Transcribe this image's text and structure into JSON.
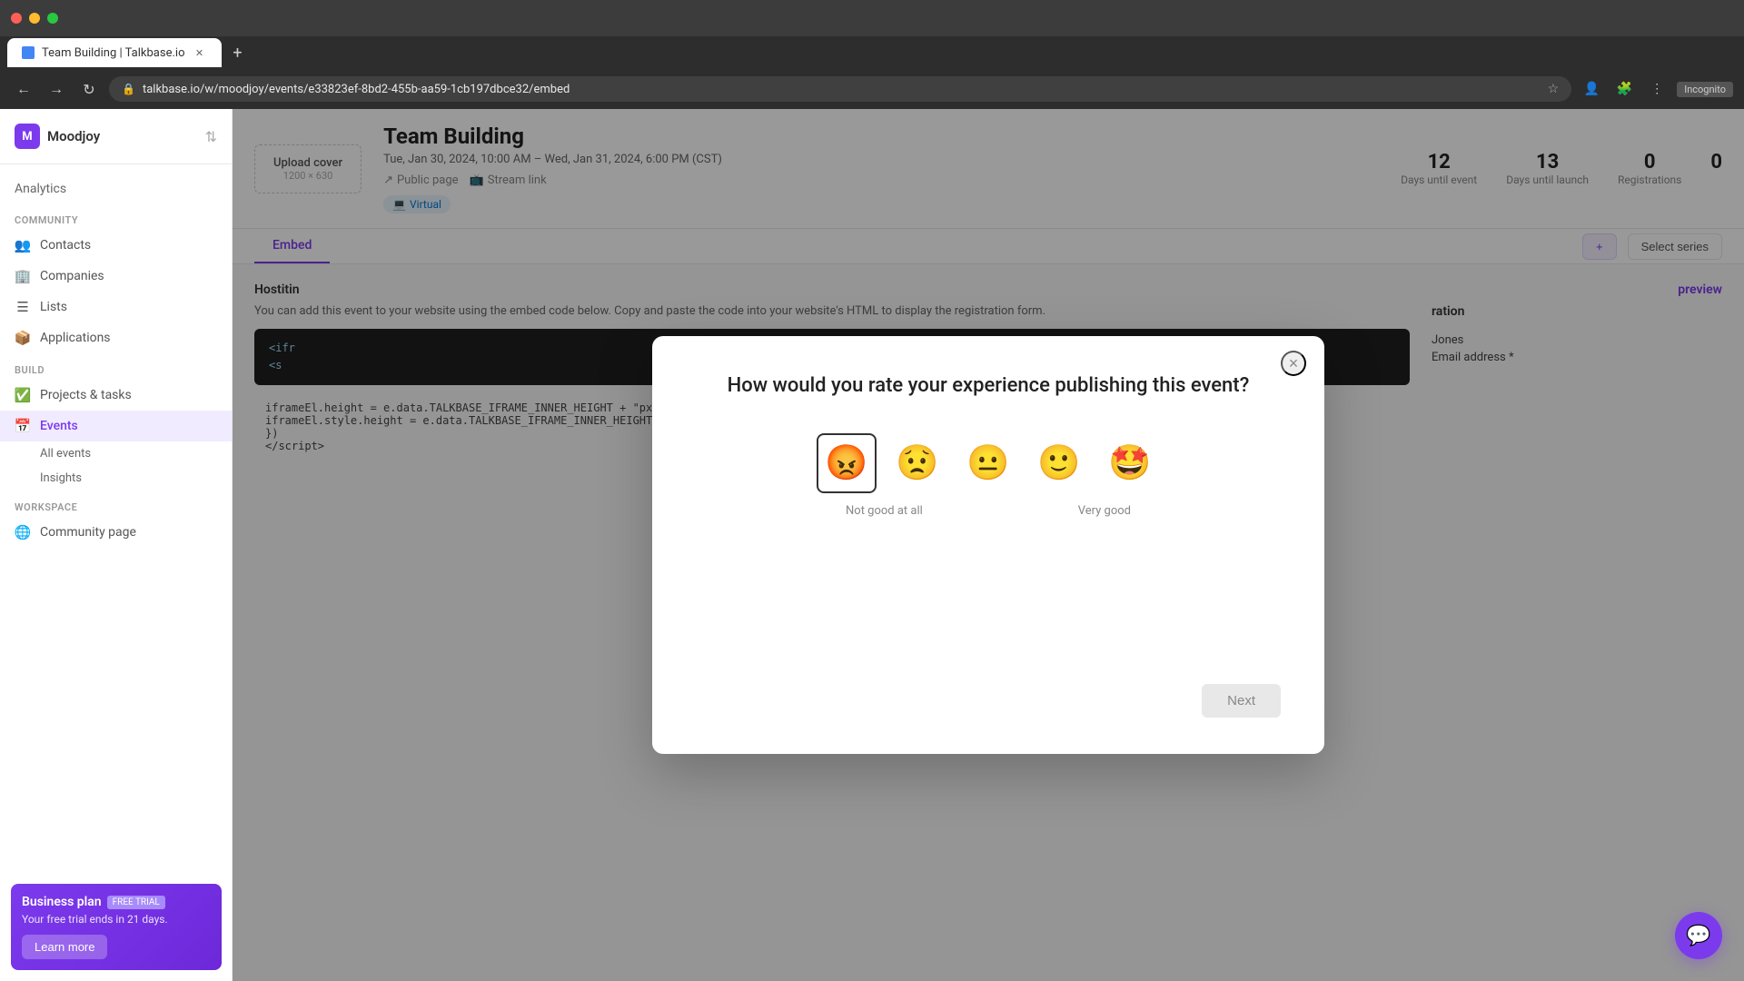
{
  "browser": {
    "url": "talkbase.io/w/moodjoy/events/e33823ef-8bd2-455b-aa59-1cb197dbce32/embed",
    "tab_title": "Team Building | Talkbase.io",
    "incognito_label": "Incognito"
  },
  "sidebar": {
    "brand_initial": "M",
    "brand_name": "Moodjoy",
    "sections": [
      {
        "title": "COMMUNITY",
        "items": [
          {
            "label": "Contacts",
            "icon": "👥",
            "active": false
          },
          {
            "label": "Companies",
            "icon": "🏢",
            "active": false
          },
          {
            "label": "Lists",
            "icon": "📋",
            "active": false
          },
          {
            "label": "Applications",
            "icon": "📦",
            "active": false
          }
        ]
      },
      {
        "title": "BUILD",
        "items": [
          {
            "label": "Projects & tasks",
            "icon": "✅",
            "active": false
          },
          {
            "label": "Events",
            "icon": "📅",
            "active": true
          }
        ]
      }
    ],
    "sub_items": [
      {
        "label": "All events"
      },
      {
        "label": "Insights"
      }
    ],
    "bottom_item": {
      "label": "Community page",
      "icon": "🌐"
    },
    "workspace_title": "WORKSPACE",
    "analytics_label": "Analytics"
  },
  "business_plan": {
    "title": "Business plan",
    "badge": "FREE TRIAL",
    "subtitle": "Your free trial ends in 21 days.",
    "learn_btn": "Learn more"
  },
  "event": {
    "title": "Team Building",
    "date": "Tue, Jan 30, 2024, 10:00 AM – Wed, Jan 31, 2024, 6:00 PM (CST)",
    "virtual_label": "Virtual",
    "public_page_label": "Public page",
    "stream_link_label": "Stream link",
    "upload_cover_label": "Upload cover",
    "upload_cover_size": "1200 × 630",
    "stats": [
      {
        "num": "12",
        "label": "Days until event"
      },
      {
        "num": "13",
        "label": "Days until launch"
      },
      {
        "num": "0",
        "label": "Registrations"
      },
      {
        "num": "0",
        "label": ""
      }
    ],
    "tabs": [
      "Embed"
    ],
    "select_series_label": "Select series",
    "tab_inner": [
      "embed"
    ],
    "active_tab": "Embed"
  },
  "modal": {
    "title": "How would you rate your experience publishing this event?",
    "close_label": "×",
    "emojis": [
      {
        "symbol": "😡",
        "label": "angry",
        "selected": true
      },
      {
        "symbol": "😟",
        "label": "sad",
        "selected": false
      },
      {
        "symbol": "😐",
        "label": "neutral",
        "selected": false
      },
      {
        "symbol": "🙂",
        "label": "happy",
        "selected": false
      },
      {
        "symbol": "🤩",
        "label": "very-happy",
        "selected": false
      }
    ],
    "label_left": "Not good at all",
    "label_right": "Very good",
    "next_btn": "Next"
  },
  "chat_btn": {
    "aria": "Open chat"
  }
}
